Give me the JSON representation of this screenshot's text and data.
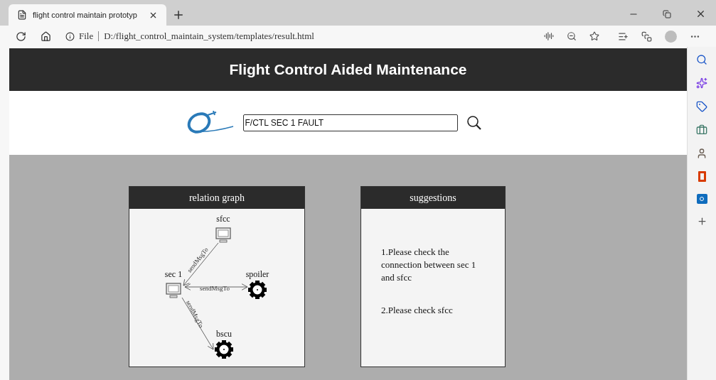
{
  "browser": {
    "tab_title": "flight control maintain prototyp",
    "address_prefix": "File",
    "url": "D:/flight_control_maintain_system/templates/result.html"
  },
  "header": {
    "title": "Flight Control Aided Maintenance"
  },
  "search": {
    "value": "F/CTL SEC 1 FAULT"
  },
  "relation_graph": {
    "title": "relation graph",
    "nodes": [
      {
        "label": "sfcc",
        "kind": "computer"
      },
      {
        "label": "sec 1",
        "kind": "computer"
      },
      {
        "label": "spoiler",
        "kind": "gear"
      },
      {
        "label": "bscu",
        "kind": "gear"
      }
    ],
    "edges": [
      {
        "label": "sendMsgTo"
      },
      {
        "label": "sendMsgTo"
      },
      {
        "label": "sendMsgTo"
      }
    ]
  },
  "suggestions": {
    "title": "suggestions",
    "items": [
      "1.Please check the connection between sec 1 and sfcc",
      "2.Please check sfcc"
    ]
  }
}
